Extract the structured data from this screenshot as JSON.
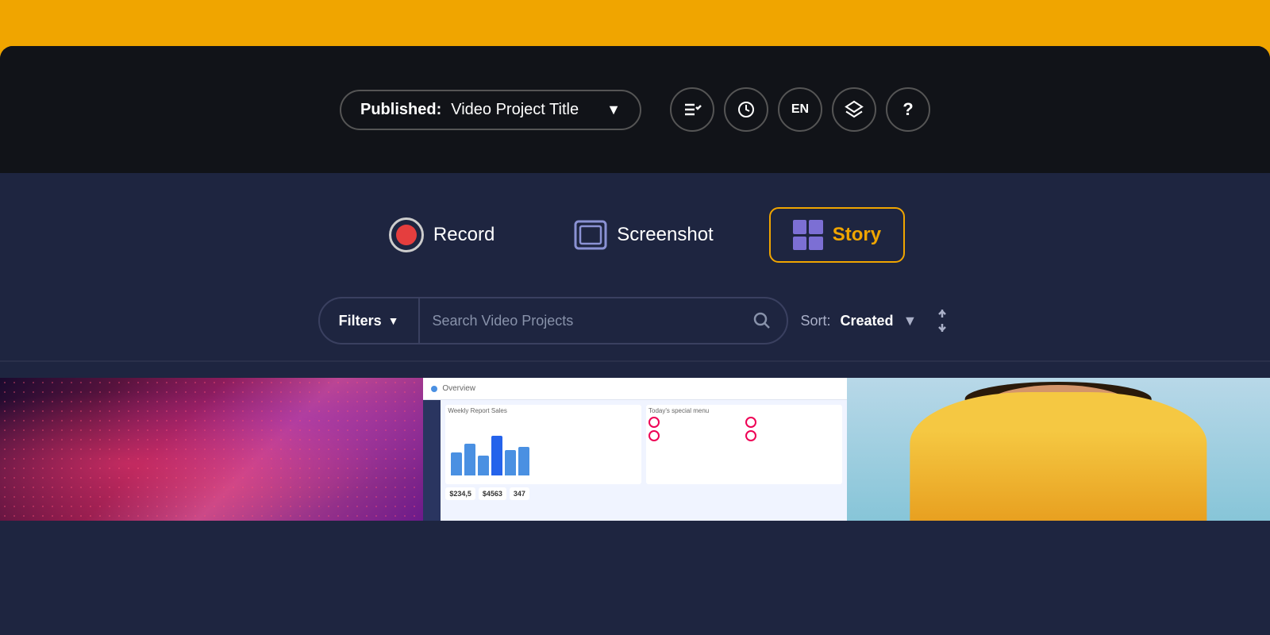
{
  "app": {
    "title": "Video Project Title"
  },
  "header": {
    "project_status": "Published:",
    "project_title": "Video Project Title",
    "chevron": "▼",
    "icons": [
      {
        "name": "checklist-icon",
        "symbol": "≡✓"
      },
      {
        "name": "history-icon",
        "symbol": "⏱"
      },
      {
        "name": "language-icon",
        "symbol": "EN"
      },
      {
        "name": "layers-icon",
        "symbol": "⊕"
      },
      {
        "name": "help-icon",
        "symbol": "?"
      }
    ]
  },
  "actions": {
    "record_label": "Record",
    "screenshot_label": "Screenshot",
    "story_label": "Story"
  },
  "search": {
    "filters_label": "Filters",
    "placeholder": "Search Video Projects",
    "sort_label": "Sort:",
    "sort_value": "Created"
  },
  "thumbnails": [
    {
      "type": "abstract"
    },
    {
      "type": "dashboard"
    },
    {
      "type": "person"
    }
  ]
}
